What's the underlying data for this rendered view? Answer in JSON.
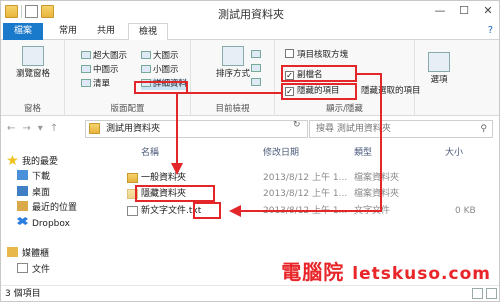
{
  "window": {
    "title": "測試用資料夾",
    "controls": [
      "—",
      "☐",
      "✕"
    ]
  },
  "ribbon_tabs": [
    "檔案",
    "常用",
    "共用",
    "檢視"
  ],
  "ribbon": {
    "nav_pane": {
      "label": "瀏覽窗格",
      "group": "窗格"
    },
    "layout": {
      "group": "版面配置",
      "options": [
        "超大圖示",
        "大圖示",
        "中圖示",
        "小圖示",
        "清單",
        "詳細資料"
      ]
    },
    "current_view": {
      "group": "目前檢視",
      "sort": "排序方式"
    },
    "show_hide": {
      "group": "顯示/隱藏",
      "checkboxes": [
        {
          "label": "項目核取方塊",
          "checked": false
        },
        {
          "label": "副檔名",
          "checked": true
        },
        {
          "label": "隱藏的項目",
          "checked": true
        }
      ],
      "hide_selected": "隱藏選取的項目"
    },
    "options": {
      "label": "選項"
    }
  },
  "address": {
    "path": "測試用資料夾",
    "search_placeholder": "搜尋 測試用資料夾"
  },
  "nav_pane": {
    "favorites": "我的最愛",
    "items": [
      "下載",
      "桌面",
      "最近的位置",
      "Dropbox"
    ],
    "libraries": "媒體櫃",
    "lib_items": [
      "文件"
    ]
  },
  "columns": [
    "名稱",
    "修改日期",
    "類型",
    "大小"
  ],
  "files": [
    {
      "name": "一般資料夾",
      "date": "2013/8/12 上午 1...",
      "type": "檔案資料夾",
      "size": ""
    },
    {
      "name": "隱藏資料夾",
      "date": "2013/8/12 上午 1...",
      "type": "檔案資料夾",
      "size": ""
    },
    {
      "name": "新文字文件.txt",
      "date": "2013/8/12 上午 1...",
      "type": "文字文件",
      "size": "0 KB"
    }
  ],
  "status": {
    "count": "3 個項目"
  },
  "watermark": {
    "cn": "電腦院",
    "latin": "letskuso.com"
  },
  "colors": {
    "accent": "#1979ca",
    "highlight": "#e3262a",
    "watermark": "#e8262a"
  }
}
